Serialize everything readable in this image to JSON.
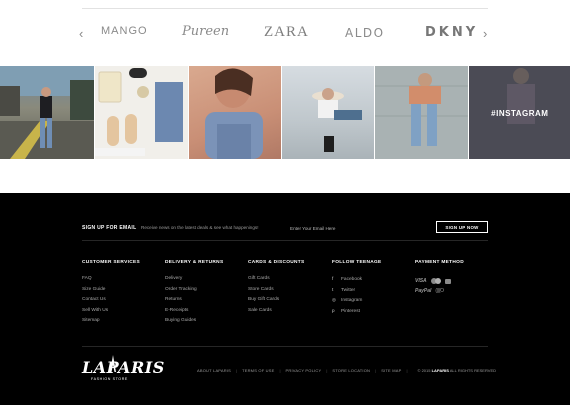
{
  "brands": {
    "items": [
      "MANGO",
      "Pureen",
      "ZARA",
      "ALDO",
      "DKNY"
    ],
    "prev_arrow": "‹",
    "next_arrow": "›"
  },
  "instagram": {
    "label": "#INSTAGRAM"
  },
  "footer": {
    "signup": {
      "title": "SIGN UP FOR EMAIL",
      "description": "Receive news on the latest deals & see what happenings!",
      "input_placeholder": "Enter Your Email Here",
      "button_label": "SIGN UP NOW"
    },
    "columns": {
      "customer_services": {
        "title": "CUSTOMER SERVICES",
        "items": [
          "FAQ",
          "Size Guide",
          "Contact Us",
          "Sell With Us",
          "Sitemap"
        ]
      },
      "delivery_returns": {
        "title": "DELIVERY & RETURNS",
        "items": [
          "Delivery",
          "Order Tracking",
          "Returns",
          "E-Receipts",
          "Buying Guides"
        ]
      },
      "cards_discounts": {
        "title": "CARDS & DISCOUNTS",
        "items": [
          "Gift Cards",
          "Store Cards",
          "Buy Gift Cards",
          "Sale Cards"
        ]
      },
      "follow": {
        "title": "FOLLOW TEENAGE",
        "items": [
          {
            "icon": "facebook-icon",
            "glyph": "f",
            "label": "Facebook"
          },
          {
            "icon": "twitter-icon",
            "glyph": "t",
            "label": "Twitter"
          },
          {
            "icon": "instagram-icon",
            "glyph": "◎",
            "label": "Instagram"
          },
          {
            "icon": "pinterest-icon",
            "glyph": "p",
            "label": "Pinterest"
          }
        ]
      },
      "payment": {
        "title": "PAYMENT METHOD",
        "visa": "VISA",
        "paypal": "PayPal",
        "waves": "((((O"
      }
    },
    "logo": {
      "text": "LAPARIS",
      "subtitle": "FASHION STORE"
    },
    "bottom_links": [
      "ABOUT LAPARIS",
      "TERMS OF USE",
      "PRIVACY POLICY",
      "STORE LOCATION",
      "SITE MAP"
    ],
    "copyright": {
      "prefix": "© 2015",
      "brand": "LAPARIS",
      "suffix": "ALL RIGHTS RESERVED"
    }
  }
}
